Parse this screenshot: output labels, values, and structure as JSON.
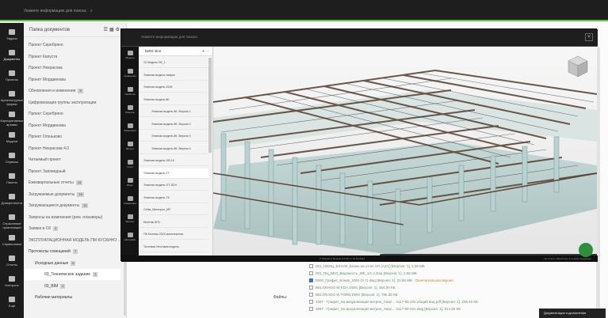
{
  "topbar": {
    "search_placeholder": "Укажите информацию для поиска"
  },
  "rail": [
    {
      "label": "Задачи",
      "icon": "tasks-icon"
    },
    {
      "label": "Документы",
      "icon": "documents-icon"
    },
    {
      "label": "Проекты",
      "icon": "projects-icon"
    },
    {
      "label": "Архитектурные формы",
      "icon": "forms-icon"
    },
    {
      "label": "Корпоративные архивы",
      "icon": "archive-icon"
    },
    {
      "label": "Модели",
      "icon": "models-icon"
    },
    {
      "label": "Сервисы",
      "icon": "services-icon"
    },
    {
      "label": "Пакеты",
      "icon": "packages-icon"
    },
    {
      "label": "Доверенности",
      "icon": "powers-icon"
    },
    {
      "label": "Отраслевые организации",
      "icon": "orgs-icon"
    },
    {
      "label": "Справочники",
      "icon": "reference-icon"
    },
    {
      "label": "Отчеты",
      "icon": "reports-icon"
    },
    {
      "label": "Контроль",
      "icon": "control-icon"
    },
    {
      "label": "Ещё",
      "icon": "more-icon"
    }
  ],
  "docs": {
    "title": "Папка документов",
    "items": [
      {
        "label": "Проект Серебряно",
        "badge": ""
      },
      {
        "label": "Проект Капуста",
        "badge": ""
      },
      {
        "label": "Проект Некрасова",
        "badge": ""
      },
      {
        "label": "Проект Мордвинова",
        "badge": ""
      },
      {
        "label": "Обновления и изменения",
        "badge": "8"
      },
      {
        "label": "Цифровизация группы эксплуатации",
        "badge": ""
      },
      {
        "label": "Проект Серебряно",
        "badge": ""
      },
      {
        "label": "Проект Мордвинова",
        "badge": ""
      },
      {
        "label": "Проект Огоньково",
        "badge": ""
      },
      {
        "label": "Проект Некрасова 4.0",
        "badge": ""
      },
      {
        "label": "Читаемый проект",
        "badge": ""
      },
      {
        "label": "Проект Заповедный",
        "badge": ""
      },
      {
        "label": "Ежеквартальные отчеты",
        "badge": "13"
      },
      {
        "label": "Загружаемые документы",
        "badge": "18"
      },
      {
        "label": "Загружающиеся документы",
        "badge": "11"
      },
      {
        "label": "Запросы на изменения (рем. планиоры)",
        "badge": ""
      },
      {
        "label": "Заявки в СК",
        "badge": "2"
      },
      {
        "label": "ЭКСПЛУАТАЦИОННАЯ МОДЕЛЬ ПМ КУСКИНО ...",
        "badge": ""
      },
      {
        "label": "Протоколы совещаний",
        "badge": "7"
      },
      {
        "label": "Исходные данные",
        "badge": "9"
      },
      {
        "label": "03_Техническое задание",
        "badge": "1"
      },
      {
        "label": "03_BIM",
        "badge": "2"
      },
      {
        "label": "Рабочие материалы",
        "badge": ""
      }
    ]
  },
  "viewer": {
    "search_placeholder": "Укажите информацию для поиска",
    "rail": [
      {
        "label": "Модель",
        "icon": "model-icon"
      },
      {
        "label": "Сравнение",
        "icon": "compare-icon"
      },
      {
        "label": "Свойства",
        "icon": "properties-icon"
      },
      {
        "label": "Разрезы",
        "icon": "sections-icon"
      },
      {
        "label": "Замечания",
        "icon": "notes-icon"
      },
      {
        "label": "Фильтр",
        "icon": "filter-icon"
      },
      {
        "label": "Слои",
        "icon": "layers-icon"
      },
      {
        "label": "Виды",
        "icon": "views-icon"
      },
      {
        "label": "Измерения",
        "icon": "measure-icon"
      },
      {
        "label": "Экспорт",
        "icon": "export-icon"
      },
      {
        "label": "Настройки",
        "icon": "settings-icon"
      }
    ],
    "tree": {
      "title": "БИМ: Все",
      "items": [
        {
          "label": "10 Модель ПК_1",
          "sub": false
        },
        {
          "label": "Этапная модель сварки",
          "sub": false
        },
        {
          "label": "Этапная модель 2018",
          "sub": false
        },
        {
          "label": "Этапная модель 8К",
          "sub": false
        },
        {
          "label": "Этапная модель 8К. Версия 1",
          "sub": true
        },
        {
          "label": "Этапная модель 8К. Версия 2",
          "sub": true
        },
        {
          "label": "Этапная модель 8К. Версия 3",
          "sub": true
        },
        {
          "label": "Этапная модель 8К. Версия 4",
          "sub": true
        },
        {
          "label": "Этапная модель ОВ-1К",
          "sub": false
        },
        {
          "label": "Этапная модель 07",
          "sub": false
        },
        {
          "label": "Этапная модель ОТ-DDV",
          "sub": false
        },
        {
          "label": "Этапная модель ТК",
          "sub": false
        },
        {
          "label": "Сейм_Мегатрон_ИР",
          "sub": false
        },
        {
          "label": "Монтаж БП1",
          "sub": false
        },
        {
          "label": "ПК Монтаж 2020 комплексная",
          "sub": false
        },
        {
          "label": "Тестовая Итоговая модель",
          "sub": false
        }
      ]
    },
    "toolbar": [
      {
        "icon": "navigation-icon"
      },
      {
        "icon": "hand-icon"
      },
      {
        "icon": "walk-down-icon"
      },
      {
        "icon": "walk-icon"
      },
      {
        "icon": "camera-icon"
      },
      {
        "icon": "pen-icon"
      },
      {
        "icon": "measure-icon"
      },
      {
        "icon": "section-icon"
      },
      {
        "icon": "layers-icon"
      },
      {
        "icon": "tree-icon"
      },
      {
        "icon": "box-icon"
      },
      {
        "icon": "floppy-icon"
      },
      {
        "icon": "gear-icon"
      },
      {
        "icon": "cube-icon"
      },
      {
        "icon": "chevron-right-icon"
      },
      {
        "icon": "refresh-icon"
      },
      {
        "icon": "info-icon"
      },
      {
        "icon": "clock-icon"
      },
      {
        "icon": "sync-icon"
      }
    ],
    "footer": {
      "center": "© Simpoint | Версия 2.5.0% от 01.09.2021",
      "right": "Не в сети: обратитесь в службу поддержки"
    }
  },
  "files": {
    "label": "Файлы:",
    "rows": [
      {
        "text": "001_НИИЦ_БЛАНК_Бланк на отчет КП (А2/1) [Версия: 1], 1,38 МБ",
        "checked": false,
        "warn": ""
      },
      {
        "text": "001_ПЦ_БЕЛ_Ведомость_ИФ_1/1-1.Ехр (Версия: 1), 2,88 МБ",
        "checked": false,
        "warn": ""
      },
      {
        "text": "0000_Графит_Конев_2004 (3-7) dwg (Версия: 1), 22,80 МБ",
        "checked": true,
        "warn": "Окончательная версия"
      },
      {
        "text": "BELGRADO W KOA.DWG [Версия: 1], 364,30 КБ",
        "checked": false,
        "warn": ""
      },
      {
        "text": "BELGRADO W TORN.DWG [Версия: 1], 796,30 КБ",
        "checked": false,
        "warn": ""
      },
      {
        "text": "1097 - Графит_Sa визуализация витрин_Анал... 4117-05-201.общий вид.pdf [Версия: 1], 205,40 КБ",
        "checked": false,
        "warn": ""
      },
      {
        "text": "1097 - Графит_Sa визуализация витрин_Анал... 4117-08-201.dwg [Версия: 1], 314,65 КБ",
        "checked": false,
        "warn": ""
      }
    ]
  },
  "footer_button": "Документация и дополнения"
}
